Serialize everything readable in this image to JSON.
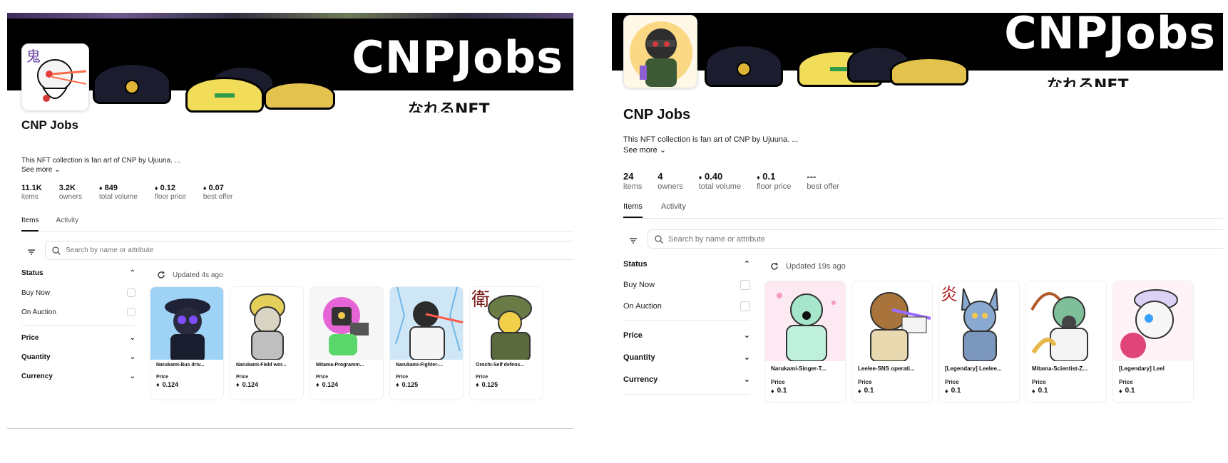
{
  "left": {
    "banner": {
      "title": "CNPJobs",
      "subtitle": "なれるNFT"
    },
    "collection": {
      "title": "CNP Jobs",
      "description": "This NFT collection is fan art of CNP by Ujuuna. ...",
      "see_more": "See more"
    },
    "stats": [
      {
        "value": "11.1K",
        "label": "items",
        "eth": false
      },
      {
        "value": "3.2K",
        "label": "owners",
        "eth": false
      },
      {
        "value": "849",
        "label": "total volume",
        "eth": true
      },
      {
        "value": "0.12",
        "label": "floor price",
        "eth": true
      },
      {
        "value": "0.07",
        "label": "best offer",
        "eth": true
      }
    ],
    "tabs": [
      {
        "label": "Items"
      },
      {
        "label": "Activity"
      }
    ],
    "search": {
      "placeholder": "Search by name or attribute"
    },
    "sidebar": {
      "status_label": "Status",
      "buy_now": "Buy Now",
      "on_auction": "On Auction",
      "price": "Price",
      "quantity": "Quantity",
      "currency": "Currency"
    },
    "updated": "Updated 4s ago",
    "cards": [
      {
        "name": "Narukami-Bus driv...",
        "price_label": "Price",
        "price": "0.124",
        "bg": "#9fd3f5",
        "char": "#1f2236"
      },
      {
        "name": "Narukami-Field wor...",
        "price_label": "Price",
        "price": "0.124",
        "bg": "#ffffff",
        "char": "#d7c25a"
      },
      {
        "name": "Mitama-Programm...",
        "price_label": "Price",
        "price": "0.124",
        "bg": "#f6f6f6",
        "char": "#e665d6"
      },
      {
        "name": "Narukami-Fighter-...",
        "price_label": "Price",
        "price": "0.125",
        "bg": "#cfe6f7",
        "char": "#f1f1f1"
      },
      {
        "name": "Orochi-Self defens...",
        "price_label": "Price",
        "price": "0.125",
        "bg": "#ffffff",
        "char": "#6b7b45"
      }
    ]
  },
  "right": {
    "banner": {
      "title": "CNPJobs",
      "subtitle": "なれるNFT"
    },
    "collection": {
      "title": "CNP Jobs",
      "description": "This NFT collection is fan art of CNP by Ujuuna. ...",
      "see_more": "See more"
    },
    "stats": [
      {
        "value": "24",
        "label": "items",
        "eth": false
      },
      {
        "value": "4",
        "label": "owners",
        "eth": false
      },
      {
        "value": "0.40",
        "label": "total volume",
        "eth": true
      },
      {
        "value": "0.1",
        "label": "floor price",
        "eth": true
      },
      {
        "value": "---",
        "label": "best offer",
        "eth": false
      }
    ],
    "tabs": [
      {
        "label": "Items"
      },
      {
        "label": "Activity"
      }
    ],
    "search": {
      "placeholder": "Search by name or attribute"
    },
    "sidebar": {
      "status_label": "Status",
      "buy_now": "Buy Now",
      "on_auction": "On Auction",
      "price": "Price",
      "quantity": "Quantity",
      "currency": "Currency"
    },
    "updated": "Updated 19s ago",
    "cards": [
      {
        "name": "Narukami-Singer-T...",
        "price_label": "Price",
        "price": "0.1",
        "bg": "#fde9f2",
        "char": "#a6e7cc"
      },
      {
        "name": "Leelee-SNS operati...",
        "price_label": "Price",
        "price": "0.1",
        "bg": "#ffffff",
        "char": "#a8743c"
      },
      {
        "name": "[Legendary] Leelee...",
        "price_label": "Price",
        "price": "0.1",
        "bg": "#ffffff",
        "char": "#8aa9d1"
      },
      {
        "name": "Mitama-Scientist-Z...",
        "price_label": "Price",
        "price": "0.1",
        "bg": "#ffffff",
        "char": "#7fbf9a"
      },
      {
        "name": "[Legendary] Leel",
        "price_label": "Price",
        "price": "0.1",
        "bg": "#fff3f7",
        "char": "#f1f1f1"
      }
    ]
  },
  "icons": {
    "eth": "♦",
    "chevron_down": "chevron-down-icon",
    "chevron_up": "chevron-up-icon",
    "search": "search-icon",
    "filter": "filter-icon",
    "refresh": "refresh-icon"
  },
  "colors": {
    "banner": "#000000",
    "text": "#111111",
    "muted": "#666666",
    "border": "#e6e6e6"
  }
}
